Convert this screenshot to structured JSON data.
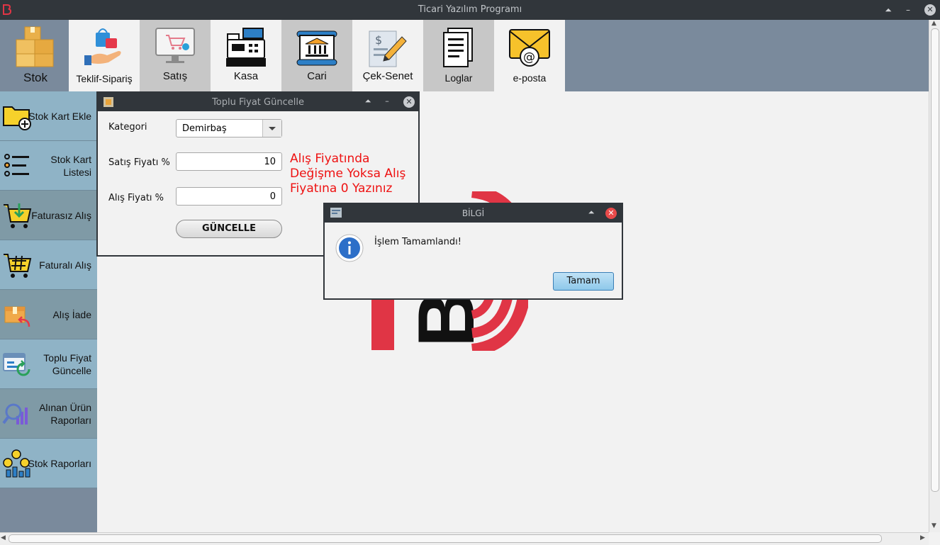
{
  "window": {
    "title": "Ticari Yazılım Programı"
  },
  "topnav": {
    "tabs": [
      {
        "label": "Stok",
        "icon": "boxes-icon"
      },
      {
        "label": "Teklif-Sipariş",
        "icon": "shopping-bag-hand-icon"
      },
      {
        "label": "Satış",
        "icon": "monitor-cart-icon"
      },
      {
        "label": "Kasa",
        "icon": "cash-register-icon"
      },
      {
        "label": "Cari",
        "icon": "bank-scroll-icon"
      },
      {
        "label": "Çek-Senet",
        "icon": "check-pen-icon"
      },
      {
        "label": "Loglar",
        "icon": "documents-icon"
      },
      {
        "label": "e-posta",
        "icon": "envelope-at-icon"
      }
    ]
  },
  "sidebar": {
    "items": [
      {
        "label": "Stok Kart Ekle",
        "icon": "folder-add-icon"
      },
      {
        "label": "Stok Kart Listesi",
        "icon": "list-icon"
      },
      {
        "label": "Faturasız Alış",
        "icon": "cart-download-icon"
      },
      {
        "label": "Faturalı Alış",
        "icon": "cart-hash-icon"
      },
      {
        "label": "Alış İade",
        "icon": "box-return-icon"
      },
      {
        "label": "Toplu Fiyat Güncelle",
        "icon": "window-refresh-icon"
      },
      {
        "label": "Alınan Ürün Raporları",
        "icon": "search-chart-icon"
      },
      {
        "label": "Stok Raporları",
        "icon": "coins-chart-icon"
      }
    ]
  },
  "bulk_price_window": {
    "title": "Toplu Fiyat Güncelle",
    "category_label": "Kategori",
    "category_value": "Demirbaş",
    "sale_label": "Satış Fiyatı %",
    "sale_value": "10",
    "purchase_label": "Alış Fiyatı %",
    "purchase_value": "0",
    "note_line1": "Alış Fiyatında",
    "note_line2": "Değişme Yoksa Alış",
    "note_line3": "Fiyatına 0 Yazınız",
    "update_button": "GÜNCELLE"
  },
  "dialog": {
    "title": "BİLGİ",
    "message": "İşlem Tamamlandı!",
    "ok_button": "Tamam"
  },
  "colors": {
    "titlebar": "#31363b",
    "nav_bg": "#7a8a9c",
    "sidebar_item": "#8fb3c6",
    "note_red": "#e11111",
    "logo_red": "#e03545"
  }
}
